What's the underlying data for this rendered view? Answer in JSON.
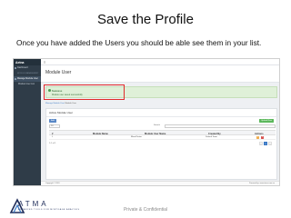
{
  "slide": {
    "title": "Save the Profile",
    "instruction": "Once you have added the Users you should be able see them in your list.",
    "footer_label": "Private & Confidential",
    "logo_text": "ATMA",
    "logo_tagline": "ADVANCED TOOLS FOR MORTGAGE ANALYSIS"
  },
  "app": {
    "logo": "Aetna",
    "sidebar": {
      "items": [
        {
          "label": "Dashboard",
          "active": false
        },
        {
          "label": "MODULE MANAGEMENT",
          "active": false
        },
        {
          "label": "Manage Module User",
          "active": true
        },
        {
          "label": "Module User List",
          "active": false
        }
      ]
    },
    "header": {
      "title": "Module User"
    },
    "alert": {
      "title": "Success",
      "message": "Module user saved successfully"
    },
    "breadcrumb": {
      "prefix": "Manage Module User",
      "current": "Module User"
    },
    "table_card": {
      "title": "Active Module User",
      "left_button": "Add",
      "right_button": "Upload New",
      "per_page": "10",
      "search_label": "Search",
      "search_value": "",
      "columns": [
        "#",
        "Module Name",
        "Module User Name",
        "Created By",
        "Actions"
      ],
      "rows": [
        {
          "index": "1",
          "module": "BluesPrinter",
          "user": "",
          "created_by": "Default Team"
        }
      ],
      "pager_text": "1-1 of 1",
      "pages": [
        "<",
        "1",
        ">"
      ]
    },
    "inactive_card": {
      "title": "Inactive Module User"
    },
    "footer": {
      "left": "Copyright © 2019",
      "right": "Powered by: www.atma.com.au"
    }
  }
}
